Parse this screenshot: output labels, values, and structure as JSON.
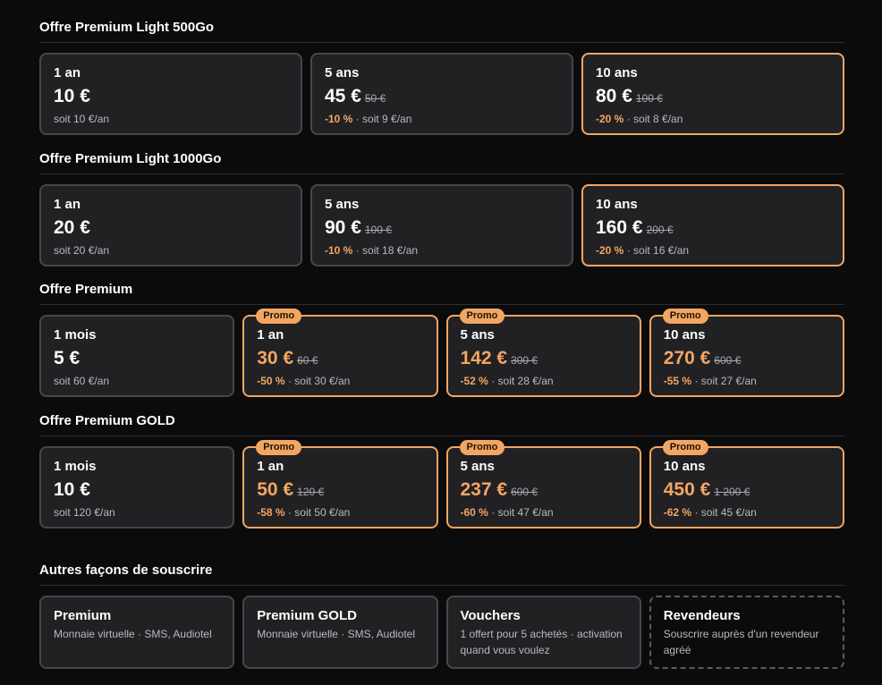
{
  "sections": [
    {
      "title": "Offre Premium Light 500Go",
      "cards": [
        {
          "duration": "1 an",
          "price": "10 €",
          "old_price": "",
          "discount": "",
          "note": "soit 10 €/an"
        },
        {
          "duration": "5 ans",
          "price": "45 €",
          "old_price": "50 €",
          "discount": "-10 %",
          "note": " · soit 9 €/an"
        },
        {
          "duration": "10 ans",
          "price": "80 €",
          "old_price": "100 €",
          "discount": "-20 %",
          "note": " · soit 8 €/an"
        }
      ]
    },
    {
      "title": "Offre Premium Light 1000Go",
      "cards": [
        {
          "duration": "1 an",
          "price": "20 €",
          "old_price": "",
          "discount": "",
          "note": "soit 20 €/an"
        },
        {
          "duration": "5 ans",
          "price": "90 €",
          "old_price": "100 €",
          "discount": "-10 %",
          "note": " · soit 18 €/an"
        },
        {
          "duration": "10 ans",
          "price": "160 €",
          "old_price": "200 €",
          "discount": "-20 %",
          "note": " · soit 16 €/an"
        }
      ]
    },
    {
      "title": "Offre Premium",
      "cards": [
        {
          "duration": "1 mois",
          "price": "5 €",
          "old_price": "",
          "discount": "",
          "note": "soit 60 €/an"
        },
        {
          "badge": "Promo",
          "duration": "1 an",
          "price": "30 €",
          "old_price": "60 €",
          "discount": "-50 %",
          "note": " · soit 30 €/an"
        },
        {
          "badge": "Promo",
          "duration": "5 ans",
          "price": "142 €",
          "old_price": "300 €",
          "discount": "-52 %",
          "note": " · soit 28 €/an"
        },
        {
          "badge": "Promo",
          "duration": "10 ans",
          "price": "270 €",
          "old_price": "600 €",
          "discount": "-55 %",
          "note": " · soit 27 €/an"
        }
      ]
    },
    {
      "title": "Offre Premium GOLD",
      "cards": [
        {
          "duration": "1 mois",
          "price": "10 €",
          "old_price": "",
          "discount": "",
          "note": "soit 120 €/an"
        },
        {
          "badge": "Promo",
          "duration": "1 an",
          "price": "50 €",
          "old_price": "120 €",
          "discount": "-58 %",
          "note": " · soit 50 €/an"
        },
        {
          "badge": "Promo",
          "duration": "5 ans",
          "price": "237 €",
          "old_price": "600 €",
          "discount": "-60 %",
          "note": " · soit 47 €/an"
        },
        {
          "badge": "Promo",
          "duration": "10 ans",
          "price": "450 €",
          "old_price": "1 200 €",
          "discount": "-62 %",
          "note": " · soit 45 €/an"
        }
      ]
    }
  ],
  "other": {
    "title": "Autres façons de souscrire",
    "items": [
      {
        "title": "Premium",
        "desc": "Monnaie virtuelle · SMS, Audiotel"
      },
      {
        "title": "Premium GOLD",
        "desc": "Monnaie virtuelle · SMS, Audiotel"
      },
      {
        "title": "Vouchers",
        "desc": "1 offert pour 5 achetés · activation quand vous voulez"
      },
      {
        "title": "Revendeurs",
        "desc": "Souscrire auprès d'un revendeur agréé"
      }
    ]
  },
  "colors": {
    "accent": "#f2a662",
    "card_bg": "#212124",
    "border": "#46464d",
    "page_bg": "#0b0b0c"
  }
}
